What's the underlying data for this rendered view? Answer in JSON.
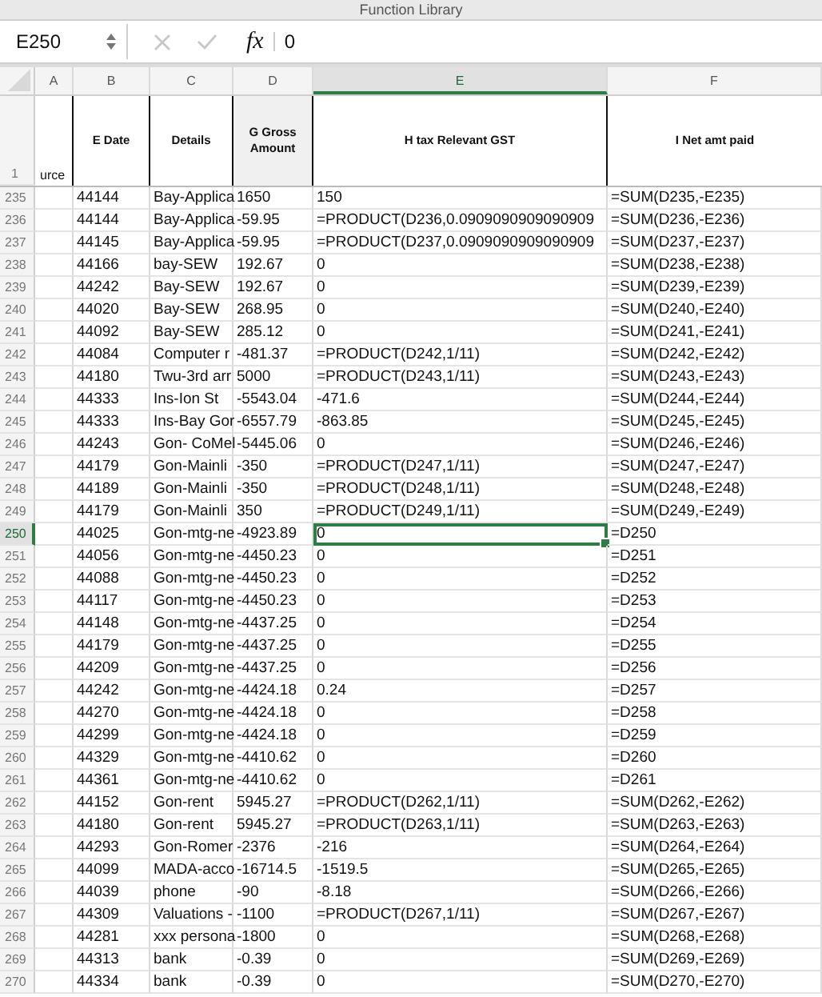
{
  "ribbon": {
    "group_label": "Function Library"
  },
  "formula_bar": {
    "name_box": "E250",
    "function_label": "fx",
    "value": "0"
  },
  "columns": [
    {
      "label": "A",
      "selected": false
    },
    {
      "label": "B",
      "selected": false
    },
    {
      "label": "C",
      "selected": false
    },
    {
      "label": "D",
      "selected": false
    },
    {
      "label": "E",
      "selected": true
    },
    {
      "label": "F",
      "selected": false
    }
  ],
  "header_row": {
    "row_number": "1",
    "cells": [
      "urce",
      "E Date",
      "Details",
      "G Gross Amount",
      "H tax Relevant  GST",
      "I Net amt paid"
    ]
  },
  "rows": [
    {
      "number": "235",
      "selected": false,
      "cells": [
        "44144",
        "Bay-Applica",
        "1650",
        "150",
        "=SUM(D235,-E235)"
      ]
    },
    {
      "number": "236",
      "selected": false,
      "cells": [
        "44144",
        "Bay-Applica",
        "-59.95",
        "=PRODUCT(D236,0.0909090909090909",
        "=SUM(D236,-E236)"
      ]
    },
    {
      "number": "237",
      "selected": false,
      "cells": [
        "44145",
        "Bay-Applica",
        "-59.95",
        "=PRODUCT(D237,0.0909090909090909",
        "=SUM(D237,-E237)"
      ]
    },
    {
      "number": "238",
      "selected": false,
      "cells": [
        "44166",
        "bay-SEW",
        "192.67",
        "0",
        "=SUM(D238,-E238)"
      ]
    },
    {
      "number": "239",
      "selected": false,
      "cells": [
        "44242",
        "Bay-SEW",
        "192.67",
        "0",
        "=SUM(D239,-E239)"
      ]
    },
    {
      "number": "240",
      "selected": false,
      "cells": [
        "44020",
        "Bay-SEW",
        "268.95",
        "0",
        "=SUM(D240,-E240)"
      ]
    },
    {
      "number": "241",
      "selected": false,
      "cells": [
        "44092",
        "Bay-SEW",
        "285.12",
        "0",
        "=SUM(D241,-E241)"
      ]
    },
    {
      "number": "242",
      "selected": false,
      "cells": [
        "44084",
        "Computer r",
        "-481.37",
        "=PRODUCT(D242,1/11)",
        "=SUM(D242,-E242)"
      ]
    },
    {
      "number": "243",
      "selected": false,
      "cells": [
        "44180",
        "Twu-3rd arr",
        "5000",
        "=PRODUCT(D243,1/11)",
        "=SUM(D243,-E243)"
      ]
    },
    {
      "number": "244",
      "selected": false,
      "cells": [
        "44333",
        "Ins-Ion St",
        "-5543.04",
        "-471.6",
        "=SUM(D244,-E244)"
      ]
    },
    {
      "number": "245",
      "selected": false,
      "cells": [
        "44333",
        "Ins-Bay Gor",
        "-6557.79",
        "-863.85",
        "=SUM(D245,-E245)"
      ]
    },
    {
      "number": "246",
      "selected": false,
      "cells": [
        "44243",
        "Gon- CoMel",
        "-5445.06",
        "0",
        "=SUM(D246,-E246)"
      ]
    },
    {
      "number": "247",
      "selected": false,
      "cells": [
        "44179",
        "Gon-Mainli",
        "-350",
        "=PRODUCT(D247,1/11)",
        "=SUM(D247,-E247)"
      ]
    },
    {
      "number": "248",
      "selected": false,
      "cells": [
        "44189",
        "Gon-Mainli",
        "-350",
        "=PRODUCT(D248,1/11)",
        "=SUM(D248,-E248)"
      ]
    },
    {
      "number": "249",
      "selected": false,
      "cells": [
        "44179",
        "Gon-Mainli",
        "350",
        "=PRODUCT(D249,1/11)",
        "=SUM(D249,-E249)"
      ]
    },
    {
      "number": "250",
      "selected": true,
      "cells": [
        "44025",
        "Gon-mtg-ne",
        "-4923.89",
        "0",
        "=D250"
      ]
    },
    {
      "number": "251",
      "selected": false,
      "cells": [
        "44056",
        "Gon-mtg-ne",
        "-4450.23",
        "0",
        "=D251"
      ]
    },
    {
      "number": "252",
      "selected": false,
      "cells": [
        "44088",
        "Gon-mtg-ne",
        "-4450.23",
        "0",
        "=D252"
      ]
    },
    {
      "number": "253",
      "selected": false,
      "cells": [
        "44117",
        "Gon-mtg-ne",
        "-4450.23",
        "0",
        "=D253"
      ]
    },
    {
      "number": "254",
      "selected": false,
      "cells": [
        "44148",
        "Gon-mtg-ne",
        "-4437.25",
        "0",
        "=D254"
      ]
    },
    {
      "number": "255",
      "selected": false,
      "cells": [
        "44179",
        "Gon-mtg-ne",
        "-4437.25",
        "0",
        "=D255"
      ]
    },
    {
      "number": "256",
      "selected": false,
      "cells": [
        "44209",
        "Gon-mtg-ne",
        "-4437.25",
        "0",
        "=D256"
      ]
    },
    {
      "number": "257",
      "selected": false,
      "cells": [
        "44242",
        "Gon-mtg-ne",
        "-4424.18",
        "0.24",
        "=D257"
      ]
    },
    {
      "number": "258",
      "selected": false,
      "cells": [
        "44270",
        "Gon-mtg-ne",
        "-4424.18",
        "0",
        "=D258"
      ]
    },
    {
      "number": "259",
      "selected": false,
      "cells": [
        "44299",
        "Gon-mtg-ne",
        "-4424.18",
        "0",
        "=D259"
      ]
    },
    {
      "number": "260",
      "selected": false,
      "cells": [
        "44329",
        "Gon-mtg-ne",
        "-4410.62",
        "0",
        "=D260"
      ]
    },
    {
      "number": "261",
      "selected": false,
      "cells": [
        "44361",
        "Gon-mtg-ne",
        "-4410.62",
        "0",
        "=D261"
      ]
    },
    {
      "number": "262",
      "selected": false,
      "cells": [
        "44152",
        "Gon-rent",
        "5945.27",
        "=PRODUCT(D262,1/11)",
        "=SUM(D262,-E262)"
      ]
    },
    {
      "number": "263",
      "selected": false,
      "cells": [
        "44180",
        "Gon-rent",
        "5945.27",
        "=PRODUCT(D263,1/11)",
        "=SUM(D263,-E263)"
      ]
    },
    {
      "number": "264",
      "selected": false,
      "cells": [
        "44293",
        "Gon-Romer",
        "-2376",
        "-216",
        "=SUM(D264,-E264)"
      ]
    },
    {
      "number": "265",
      "selected": false,
      "cells": [
        "44099",
        "MADA-acco",
        "-16714.5",
        "-1519.5",
        "=SUM(D265,-E265)"
      ]
    },
    {
      "number": "266",
      "selected": false,
      "cells": [
        "44039",
        "phone",
        "-90",
        "-8.18",
        "=SUM(D266,-E266)"
      ]
    },
    {
      "number": "267",
      "selected": false,
      "cells": [
        "44309",
        "Valuations -",
        "-1100",
        "=PRODUCT(D267,1/11)",
        "=SUM(D267,-E267)"
      ]
    },
    {
      "number": "268",
      "selected": false,
      "cells": [
        "44281",
        "xxx persona",
        "-1800",
        "0",
        "=SUM(D268,-E268)"
      ]
    },
    {
      "number": "269",
      "selected": false,
      "cells": [
        "44313",
        "bank",
        "-0.39",
        "0",
        "=SUM(D269,-E269)"
      ]
    },
    {
      "number": "270",
      "selected": false,
      "cells": [
        "44334",
        "bank",
        "-0.39",
        "0",
        "=SUM(D270,-E270)"
      ]
    }
  ]
}
